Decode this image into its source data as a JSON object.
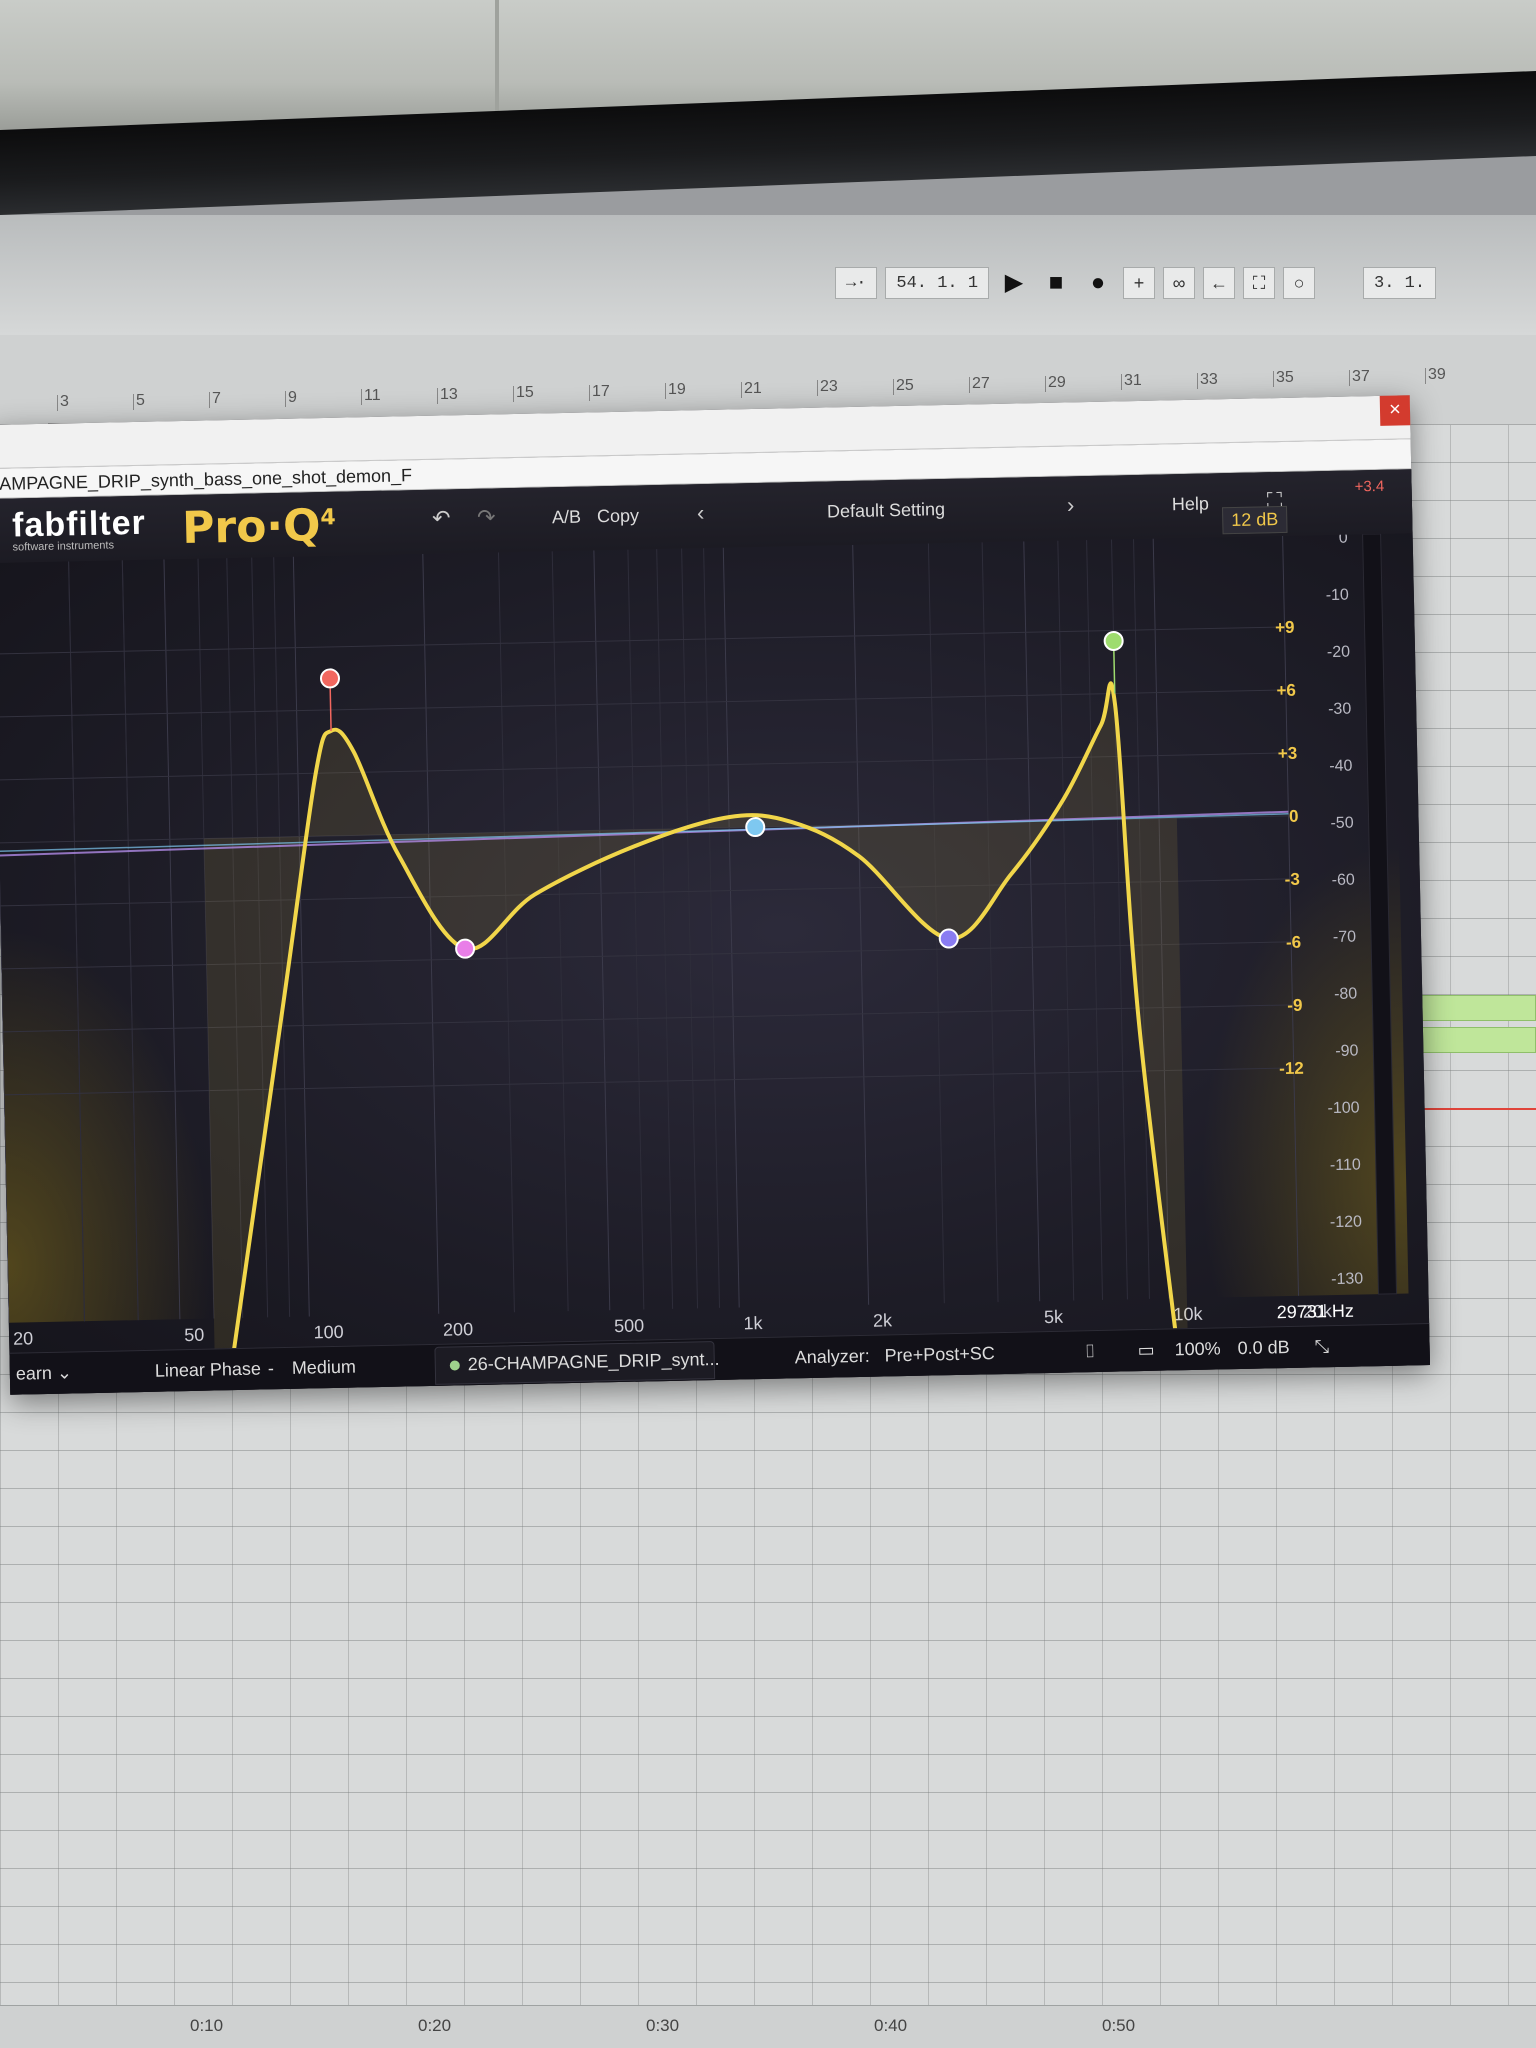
{
  "daw": {
    "transport": {
      "position": "54. 1. 1",
      "position_right": "3. 1.",
      "play_icon": "play-icon",
      "stop_icon": "stop-icon",
      "record_icon": "record-icon"
    },
    "bar_ruler": [
      "3",
      "5",
      "7",
      "9",
      "11",
      "13",
      "15",
      "17",
      "19",
      "21",
      "23",
      "25",
      "27",
      "29",
      "31",
      "33",
      "35",
      "37",
      "39"
    ],
    "time_ruler": [
      "0:10",
      "0:20",
      "0:30",
      "0:40",
      "0:50"
    ]
  },
  "plugin_window": {
    "close_label": "×",
    "track_title": "AMPAGNE_DRIP_synth_bass_one_shot_demon_F"
  },
  "proq": {
    "brand": "fabfilter",
    "brand_sub": "software instruments",
    "product": "Pro·Q",
    "product_version": "4",
    "undo_icon": "undo-icon",
    "redo_icon": "redo-icon",
    "ab_label": "A/B",
    "copy_label": "Copy",
    "prev_preset_icon": "chevron-left-icon",
    "preset_name": "Default Setting",
    "next_preset_icon": "chevron-right-icon",
    "help_label": "Help",
    "fullscreen_icon": "fullscreen-icon",
    "range_label": "12 dB",
    "peak_readout": "+3.4",
    "footer": {
      "mode": "earn",
      "processing": "Linear Phase",
      "separator": "-",
      "quality": "Medium",
      "sidechain_track": "26-CHAMPAGNE_DRIP_synt...",
      "analyzer_label": "Analyzer:",
      "analyzer_value": "Pre+Post+SC",
      "zoom": "100%",
      "output_gain": "0.0 dB"
    },
    "accent_color": "#f1c84a"
  },
  "chart_data": {
    "type": "line",
    "x_scale": "log",
    "xlim_hz": [
      20,
      20000
    ],
    "x_tick_labels": [
      "20",
      "50",
      "100",
      "200",
      "500",
      "1k",
      "2k",
      "5k",
      "10k",
      "20k"
    ],
    "eq_gain_ticks": [
      "+9",
      "+6",
      "+3",
      "0",
      "-3",
      "-6",
      "-9",
      "-12"
    ],
    "analyzer_db_ticks": [
      "0",
      "-10",
      "-20",
      "-30",
      "-40",
      "-50",
      "-60",
      "-70",
      "-80",
      "-90",
      "-100",
      "-110",
      "-120",
      "-130"
    ],
    "cursor_readout": "29731 Hz",
    "bands": [
      {
        "color": "#f2675f",
        "type": "high-pass (steep) + resonant peak",
        "freq_hz": 120,
        "gain_db": 7.5
      },
      {
        "color": "#e97ee8",
        "type": "bell",
        "freq_hz": 240,
        "gain_db": -5.5
      },
      {
        "color": "#7ec8f0",
        "type": "bell",
        "freq_hz": 1150,
        "gain_db": 0
      },
      {
        "color": "#8a7cf2",
        "type": "bell",
        "freq_hz": 3200,
        "gain_db": -5.5
      },
      {
        "color": "#9edc6e",
        "type": "low-pass (steep) + resonant peak",
        "freq_hz": 8000,
        "gain_db": 8.5
      }
    ],
    "summed_curve": {
      "color": "#f1d64a",
      "freq_hz": [
        60,
        90,
        110,
        120,
        135,
        170,
        240,
        350,
        600,
        1000,
        1400,
        2000,
        3200,
        4500,
        6000,
        7400,
        8000,
        8800,
        11000
      ],
      "gain_db": [
        -30,
        -8,
        3,
        5,
        4,
        -1,
        -5.5,
        -3,
        -0.8,
        0.5,
        0.2,
        -1.5,
        -5.5,
        -2.5,
        1,
        4.5,
        5.5,
        -10,
        -30
      ]
    }
  }
}
